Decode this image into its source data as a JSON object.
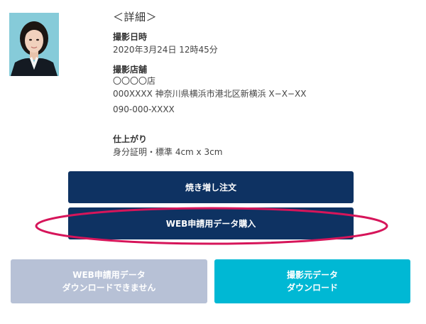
{
  "detail": {
    "title": "＜詳細＞",
    "shoot_datetime": {
      "label": "撮影日時",
      "value": "2020年3月24日 12時45分"
    },
    "store": {
      "label": "撮影店舗",
      "name": "〇〇〇〇店",
      "address": "000XXXX 神奈川県横浜市港北区新横浜 X−X−XX",
      "phone": "090-000-XXXX"
    },
    "finish": {
      "label": "仕上がり",
      "value": "身分証明・標準 4cm x 3cm"
    }
  },
  "buttons": {
    "reprint": "焼き増し注文",
    "web_data_purchase": "WEB申請用データ購入",
    "web_download_disabled": [
      "WEB申請用データ",
      "ダウンロードできません"
    ],
    "original_download": [
      "撮影元データ",
      "ダウンロード"
    ]
  },
  "colors": {
    "primary": "#0e3262",
    "disabled": "#b7c1d6",
    "cyan": "#00b8d4",
    "highlight": "#d6155a"
  }
}
